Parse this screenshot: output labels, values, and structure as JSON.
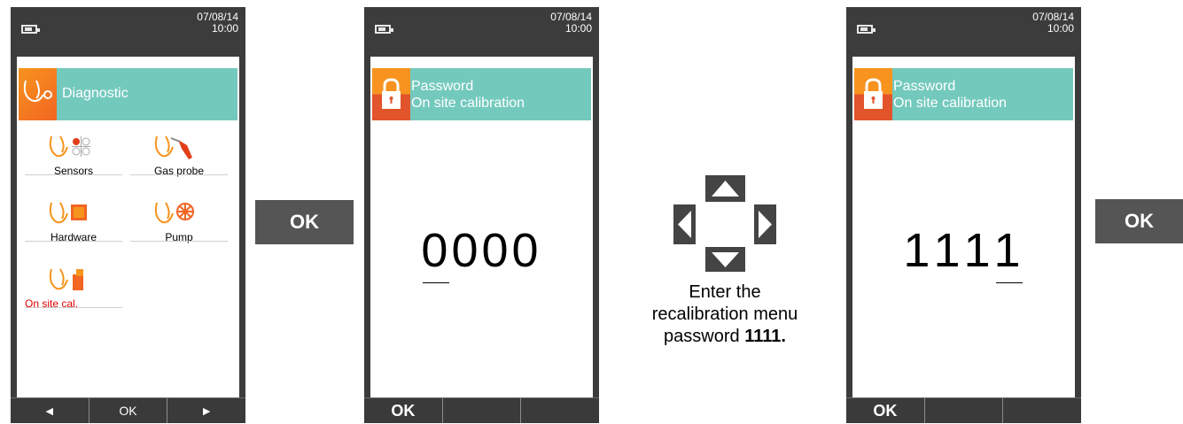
{
  "status": {
    "date": "07/08/14",
    "time": "10:00"
  },
  "screen1": {
    "title": "Diagnostic",
    "tiles": [
      {
        "label": "Sensors"
      },
      {
        "label": "Gas probe"
      },
      {
        "label": "Hardware"
      },
      {
        "label": "Pump"
      },
      {
        "label": "On site cal."
      }
    ],
    "softkeys": [
      "◄",
      "OK",
      "►"
    ]
  },
  "screen2": {
    "title_line1": "Password",
    "title_line2": "On site calibration",
    "digits": [
      "0",
      "0",
      "0",
      "0"
    ],
    "softkey_ok": "OK"
  },
  "screen3": {
    "title_line1": "Password",
    "title_line2": "On site calibration",
    "digits": [
      "1",
      "1",
      "1",
      "1"
    ],
    "softkey_ok": "OK"
  },
  "ok_button_label": "OK",
  "instruction": {
    "line1": "Enter the",
    "line2": "recalibration menu",
    "line3_prefix": "password ",
    "line3_bold": "1111."
  },
  "colors": {
    "accent_teal": "#74c9bd",
    "accent_orange": "#f26522",
    "device_body": "#3c3c3c",
    "ok_button": "#555555",
    "selected_text": "#e00000"
  }
}
